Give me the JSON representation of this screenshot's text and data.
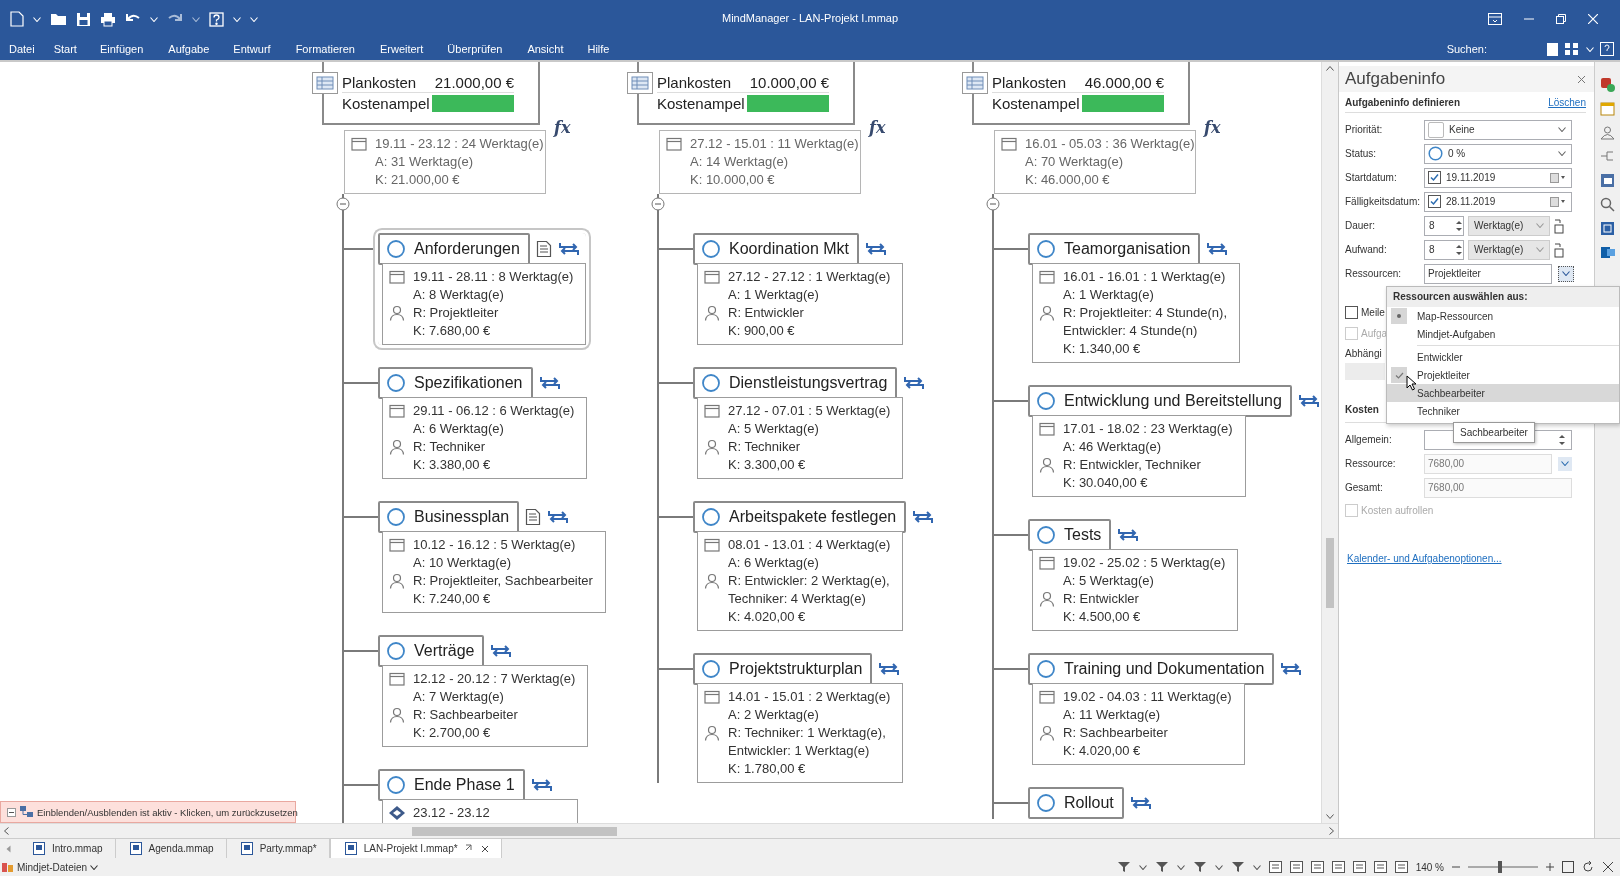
{
  "window": {
    "title": "MindManager - LAN-Projekt I.mmap"
  },
  "menu": {
    "items": [
      "Datei",
      "Start",
      "Einfügen",
      "Aufgabe",
      "Entwurf",
      "Formatieren",
      "Erweitert",
      "Überprüfen",
      "Ansicht",
      "Hilfe"
    ],
    "search_label": "Suchen:"
  },
  "map": {
    "phases": [
      {
        "plankosten_label": "Plankosten",
        "plankosten": "21.000,00 €",
        "ampel_label": "Kostenampel",
        "formula_mark": "fx",
        "summary": [
          "19.11 - 23.12 : 24 Werktag(e)",
          "A: 31 Werktag(e)",
          "K: 21.000,00 €"
        ],
        "tasks": [
          {
            "title": "Anforderungen",
            "selected": true,
            "note": true,
            "lines": [
              {
                "kind": "date",
                "text": "19.11 - 28.11 : 8 Werktag(e)"
              },
              {
                "kind": "plain",
                "text": "A: 8 Werktag(e)"
              },
              {
                "kind": "resource",
                "text": "R: Projektleiter"
              },
              {
                "kind": "plain",
                "text": "K: 7.680,00 €"
              }
            ]
          },
          {
            "title": "Spezifikationen",
            "selected": false,
            "note": false,
            "lines": [
              {
                "kind": "date",
                "text": "29.11 - 06.12 : 6 Werktag(e)"
              },
              {
                "kind": "plain",
                "text": "A: 6 Werktag(e)"
              },
              {
                "kind": "resource",
                "text": "R: Techniker"
              },
              {
                "kind": "plain",
                "text": "K: 3.380,00 €"
              }
            ]
          },
          {
            "title": "Businessplan",
            "selected": false,
            "note": true,
            "lines": [
              {
                "kind": "date",
                "text": "10.12 - 16.12 : 5 Werktag(e)"
              },
              {
                "kind": "plain",
                "text": "A: 10 Werktag(e)"
              },
              {
                "kind": "resource",
                "text": "R: Projektleiter, Sachbearbeiter"
              },
              {
                "kind": "plain",
                "text": "K: 7.240,00 €"
              }
            ]
          },
          {
            "title": "Verträge",
            "selected": false,
            "note": false,
            "lines": [
              {
                "kind": "date",
                "text": "12.12 - 20.12 : 7 Werktag(e)"
              },
              {
                "kind": "plain",
                "text": "A: 7 Werktag(e)"
              },
              {
                "kind": "resource",
                "text": "R: Sachbearbeiter"
              },
              {
                "kind": "plain",
                "text": "K: 2.700,00 €"
              }
            ]
          },
          {
            "title": "Ende Phase 1",
            "selected": false,
            "note": false,
            "lines": [
              {
                "kind": "milestone",
                "text": "23.12 - 23.12"
              }
            ]
          }
        ]
      },
      {
        "plankosten_label": "Plankosten",
        "plankosten": "10.000,00 €",
        "ampel_label": "Kostenampel",
        "formula_mark": "fx",
        "summary": [
          "27.12 - 15.01 : 11 Werktag(e)",
          "A: 14 Werktag(e)",
          "K: 10.000,00 €"
        ],
        "tasks": [
          {
            "title": "Koordination Mkt",
            "selected": false,
            "note": false,
            "lines": [
              {
                "kind": "date",
                "text": "27.12 - 27.12 : 1 Werktag(e)"
              },
              {
                "kind": "plain",
                "text": "A: 1 Werktag(e)"
              },
              {
                "kind": "resource",
                "text": "R: Entwickler"
              },
              {
                "kind": "plain",
                "text": "K: 900,00 €"
              }
            ]
          },
          {
            "title": "Dienstleistungsvertrag",
            "selected": false,
            "note": false,
            "lines": [
              {
                "kind": "date",
                "text": "27.12 - 07.01 : 5 Werktag(e)"
              },
              {
                "kind": "plain",
                "text": "A: 5 Werktag(e)"
              },
              {
                "kind": "resource",
                "text": "R: Techniker"
              },
              {
                "kind": "plain",
                "text": "K: 3.300,00 €"
              }
            ]
          },
          {
            "title": "Arbeitspakete festlegen",
            "selected": false,
            "note": false,
            "lines": [
              {
                "kind": "date",
                "text": "08.01 - 13.01 : 4 Werktag(e)"
              },
              {
                "kind": "plain",
                "text": "A: 6 Werktag(e)"
              },
              {
                "kind": "resource",
                "text": "R: Entwickler: 2 Werktag(e),"
              },
              {
                "kind": "plain",
                "text": "Techniker: 4 Werktag(e)"
              },
              {
                "kind": "plain",
                "text": "K: 4.020,00 €"
              }
            ]
          },
          {
            "title": "Projektstrukturplan",
            "selected": false,
            "note": false,
            "lines": [
              {
                "kind": "date",
                "text": "14.01 - 15.01 : 2 Werktag(e)"
              },
              {
                "kind": "plain",
                "text": "A: 2 Werktag(e)"
              },
              {
                "kind": "resource",
                "text": "R: Techniker: 1 Werktag(e),"
              },
              {
                "kind": "plain",
                "text": "Entwickler: 1 Werktag(e)"
              },
              {
                "kind": "plain",
                "text": "K: 1.780,00 €"
              }
            ]
          }
        ]
      },
      {
        "plankosten_label": "Plankosten",
        "plankosten": "46.000,00 €",
        "ampel_label": "Kostenampel",
        "formula_mark": "fx",
        "summary": [
          "16.01 - 05.03 : 36 Werktag(e)",
          "A: 70 Werktag(e)",
          "K: 46.000,00 €"
        ],
        "tasks": [
          {
            "title": "Teamorganisation",
            "selected": false,
            "note": false,
            "lines": [
              {
                "kind": "date",
                "text": "16.01 - 16.01 : 1 Werktag(e)"
              },
              {
                "kind": "plain",
                "text": "A: 1 Werktag(e)"
              },
              {
                "kind": "resource",
                "text": "R: Projektleiter: 4 Stunde(n),"
              },
              {
                "kind": "plain",
                "text": "Entwickler: 4 Stunde(n)"
              },
              {
                "kind": "plain",
                "text": "K: 1.340,00 €"
              }
            ]
          },
          {
            "title": "Entwicklung und Bereitstellung",
            "selected": false,
            "note": false,
            "lines": [
              {
                "kind": "date",
                "text": "17.01 - 18.02 : 23 Werktag(e)"
              },
              {
                "kind": "plain",
                "text": "A: 46 Werktag(e)"
              },
              {
                "kind": "resource",
                "text": "R: Entwickler, Techniker"
              },
              {
                "kind": "plain",
                "text": "K: 30.040,00 €"
              }
            ]
          },
          {
            "title": "Tests",
            "selected": false,
            "note": false,
            "lines": [
              {
                "kind": "date",
                "text": "19.02 - 25.02 : 5 Werktag(e)"
              },
              {
                "kind": "plain",
                "text": "A: 5 Werktag(e)"
              },
              {
                "kind": "resource",
                "text": "R: Entwickler"
              },
              {
                "kind": "plain",
                "text": "K: 4.500,00 €"
              }
            ]
          },
          {
            "title": "Training und Dokumentation",
            "selected": false,
            "note": false,
            "lines": [
              {
                "kind": "date",
                "text": "19.02 - 04.03 : 11 Werktag(e)"
              },
              {
                "kind": "plain",
                "text": "A: 11 Werktag(e)"
              },
              {
                "kind": "resource",
                "text": "R: Sachbearbeiter"
              },
              {
                "kind": "plain",
                "text": "K: 4.020,00 €"
              }
            ]
          },
          {
            "title": "Rollout",
            "selected": false,
            "note": false
          }
        ]
      }
    ],
    "notification": "Einblenden/Ausblenden ist aktiv - Klicken, um zurückzusetzen"
  },
  "task_info": {
    "title": "Aufgabeninfo",
    "section": "Aufgabeninfo definieren",
    "clear_link": "Löschen",
    "fields": [
      {
        "kind": "priority",
        "label": "Priorität:",
        "value": "Keine"
      },
      {
        "kind": "status",
        "label": "Status:",
        "value": "0 %"
      },
      {
        "kind": "date",
        "label": "Startdatum:",
        "value": "19.11.2019",
        "checked": true
      },
      {
        "kind": "date",
        "label": "Fälligkeitsdatum:",
        "value": "28.11.2019",
        "checked": true
      },
      {
        "kind": "spin",
        "label": "Dauer:",
        "value": "8",
        "unit": "Werktag(e)"
      },
      {
        "kind": "spin",
        "label": "Aufwand:",
        "value": "8",
        "unit": "Werktag(e)"
      },
      {
        "kind": "resource",
        "label": "Ressourcen:",
        "value": "Projektleiter"
      }
    ],
    "options": [
      {
        "label": "Meile",
        "checked": false,
        "disabled": false
      },
      {
        "label": "Aufga",
        "checked": false,
        "disabled": true
      }
    ],
    "dependencies_label": "Abhängi",
    "costs_title": "Kosten",
    "cost_fields": [
      {
        "kind": "spin",
        "label": "Allgemein:"
      },
      {
        "kind": "dropdown",
        "label": "Ressource:",
        "value": "7680,00"
      },
      {
        "kind": "text",
        "label": "Gesamt:",
        "value": "7680,00"
      }
    ],
    "rollup": {
      "label": "Kosten aufrollen",
      "checked": false,
      "disabled": true
    },
    "options_link": "Kalender- und Aufgabenoptionen..."
  },
  "resource_menu": {
    "header": "Ressourcen auswählen aus:",
    "sources": [
      {
        "label": "Map-Ressourcen",
        "selected": true
      },
      {
        "label": "Mindjet-Aufgaben",
        "selected": false
      }
    ],
    "resources": [
      {
        "label": "Entwickler",
        "checked": false,
        "hovered": false
      },
      {
        "label": "Projektleiter",
        "checked": true,
        "hovered": false
      },
      {
        "label": "Sachbearbeiter",
        "checked": false,
        "hovered": true
      },
      {
        "label": "Techniker",
        "checked": false,
        "hovered": false
      }
    ],
    "tooltip": "Sachbearbeiter"
  },
  "tabs": [
    {
      "label": "Intro.mmap",
      "selected": false
    },
    {
      "label": "Agenda.mmap",
      "selected": false
    },
    {
      "label": "Party.mmap*",
      "selected": false
    },
    {
      "label": "LAN-Projekt I.mmap*",
      "selected": true
    }
  ],
  "status_bar": {
    "library": "Mindjet-Dateien",
    "zoom": "140 %",
    "zoom_slider": {
      "level": 0.45
    }
  }
}
